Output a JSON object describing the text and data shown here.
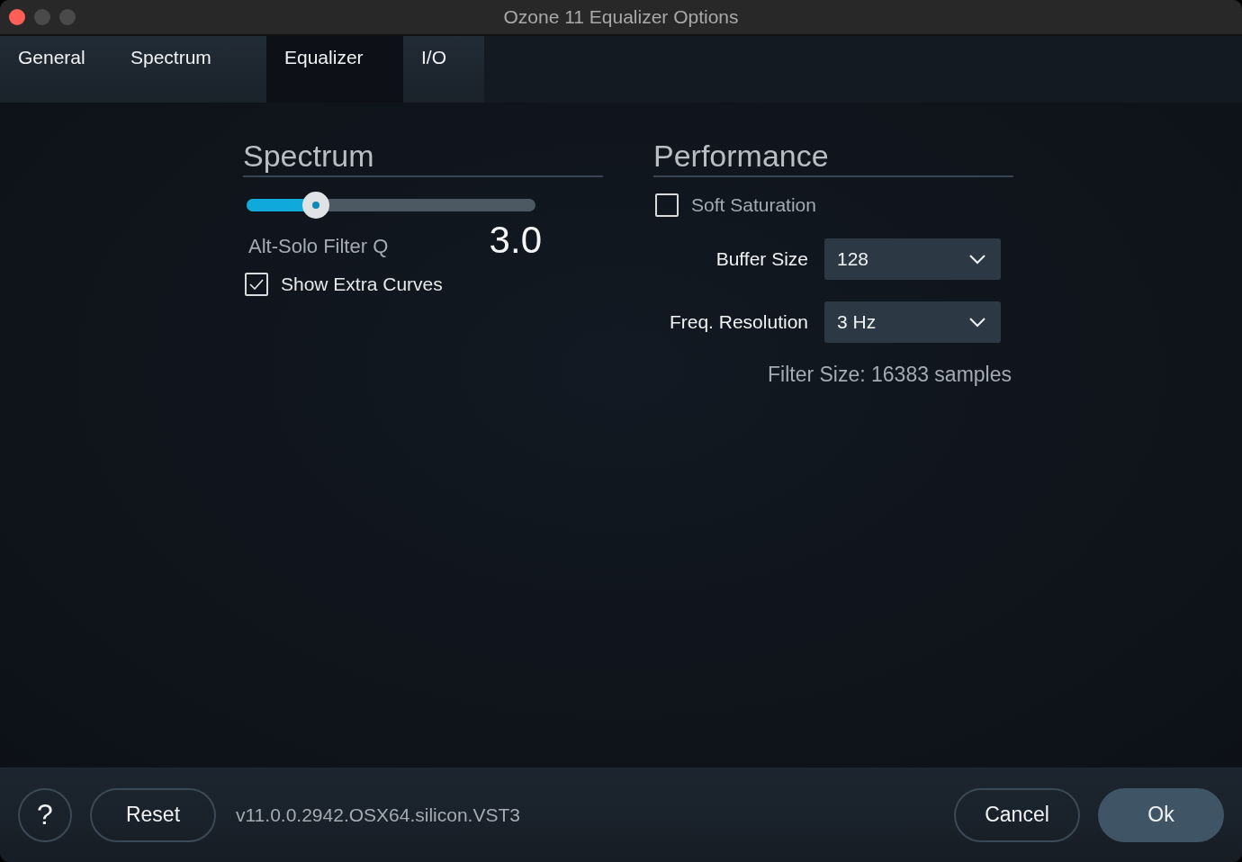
{
  "window": {
    "title": "Ozone 11 Equalizer Options"
  },
  "tabs": [
    {
      "label": "General",
      "selected": false
    },
    {
      "label": "Spectrum",
      "selected": false
    },
    {
      "label": "Equalizer",
      "selected": true
    },
    {
      "label": "I/O",
      "selected": false
    }
  ],
  "spectrum": {
    "heading": "Spectrum",
    "slider": {
      "label": "Alt-Solo Filter Q",
      "reading": "3.0",
      "level": 0.24
    },
    "checkbox": {
      "label": "Show Extra Curves",
      "checked": true
    }
  },
  "performance": {
    "heading": "Performance",
    "checkbox": {
      "label": "Soft Saturation",
      "checked": false
    },
    "dropdowns": [
      {
        "label": "Buffer Size",
        "value": "128"
      },
      {
        "label": "Freq. Resolution",
        "value": "3 Hz"
      }
    ],
    "note": "Filter Size: 16383 samples"
  },
  "footer": {
    "help": "?",
    "reset": "Reset",
    "version": "v11.0.0.2942.OSX64.silicon.VST3",
    "cancel": "Cancel",
    "ok": "Ok"
  }
}
